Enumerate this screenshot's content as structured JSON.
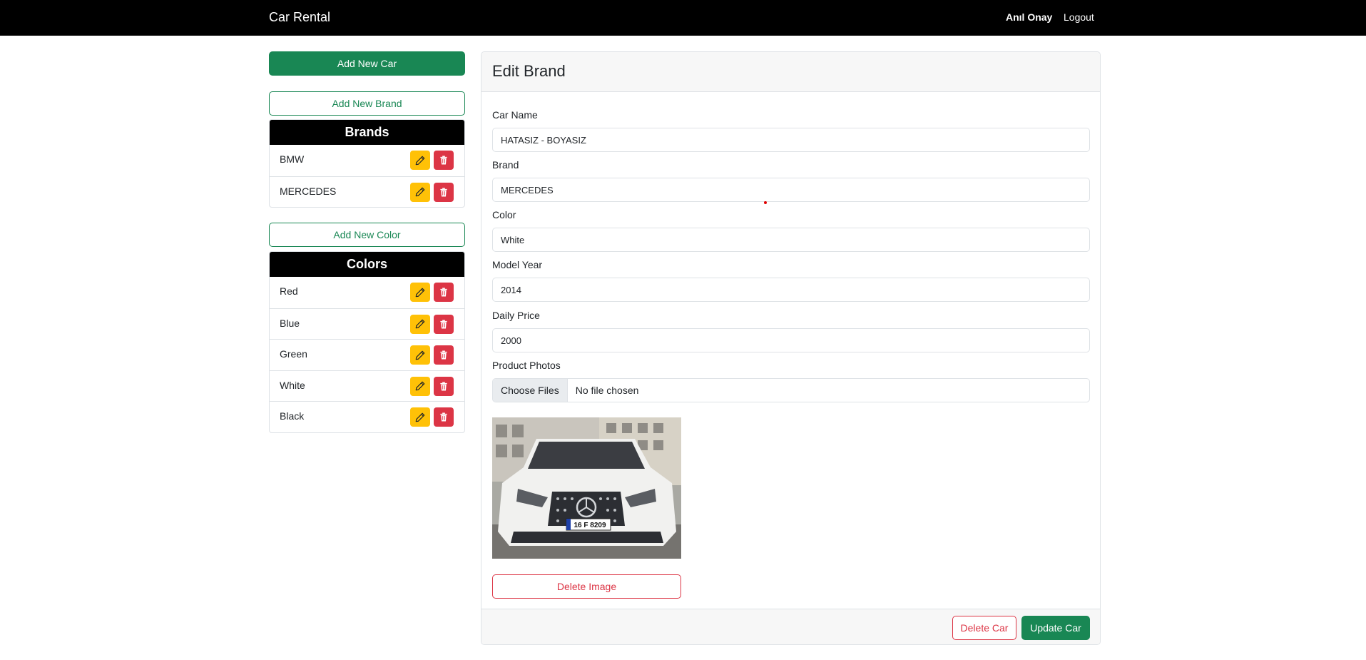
{
  "navbar": {
    "title": "Car Rental",
    "user": "Anıl Onay",
    "logout": "Logout"
  },
  "sidebar": {
    "add_car": "Add New Car",
    "add_brand": "Add New Brand",
    "brands_title": "Brands",
    "brands": [
      {
        "label": "BMW"
      },
      {
        "label": "MERCEDES"
      }
    ],
    "add_color": "Add New Color",
    "colors_title": "Colors",
    "colors": [
      {
        "label": "Red"
      },
      {
        "label": "Blue"
      },
      {
        "label": "Green"
      },
      {
        "label": "White"
      },
      {
        "label": "Black"
      }
    ]
  },
  "form": {
    "title": "Edit Brand",
    "car_name_label": "Car Name",
    "car_name": "HATASIZ - BOYASIZ",
    "brand_label": "Brand",
    "brand": "MERCEDES",
    "color_label": "Color",
    "color": "White",
    "model_year_label": "Model Year",
    "model_year": "2014",
    "daily_price_label": "Daily Price",
    "daily_price": "2000",
    "photos_label": "Product Photos",
    "file_button": "Choose Files",
    "file_status": "No file chosen",
    "plate": "16 F 8209",
    "delete_image": "Delete Image",
    "delete_car": "Delete Car",
    "update_car": "Update Car"
  },
  "colors": {
    "navbar": "#000000",
    "success": "#198754",
    "warning": "#ffc107",
    "danger": "#dc3545"
  }
}
